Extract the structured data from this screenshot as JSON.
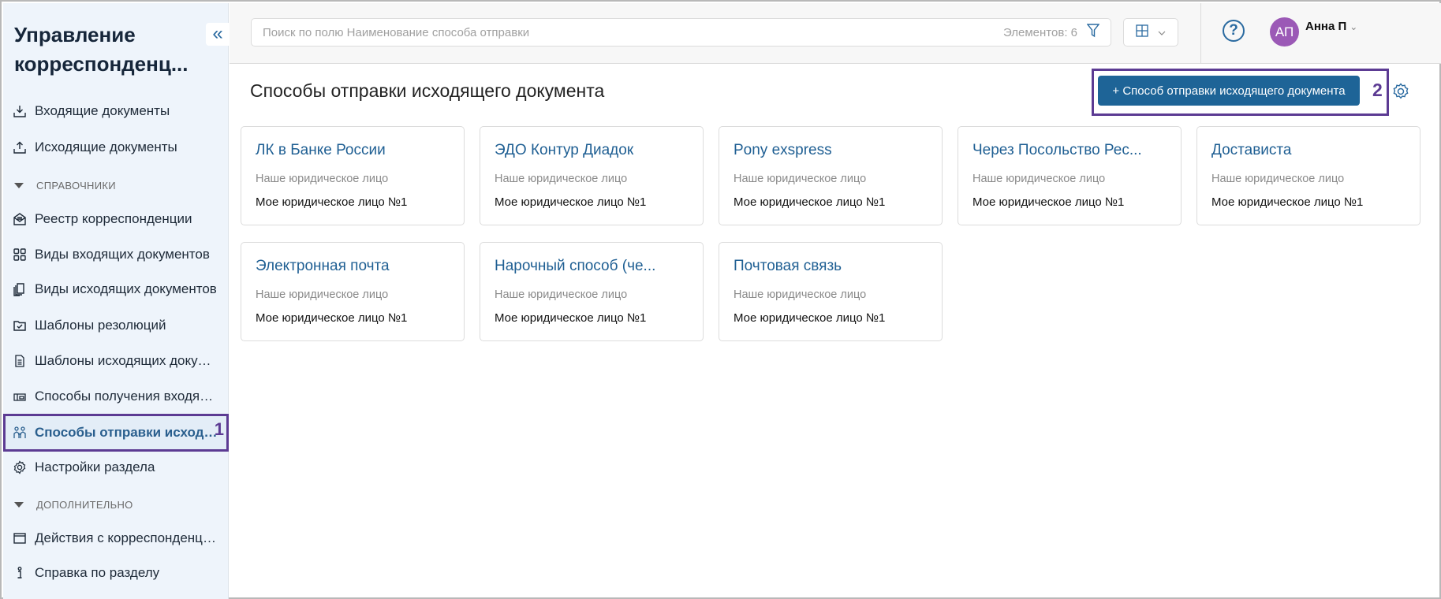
{
  "sidebar": {
    "title": "Управление корреспонденц...",
    "collapse_icon": "«",
    "items": [
      {
        "label": "Входящие документы",
        "icon": "inbox-download-icon"
      },
      {
        "label": "Исходящие документы",
        "icon": "outbox-upload-icon"
      },
      {
        "label": "Реестр корреспонденции",
        "icon": "mail-registry-icon"
      },
      {
        "label": "Виды входящих документов",
        "icon": "grid-icon"
      },
      {
        "label": "Виды исходящих документов",
        "icon": "documents-stack-icon"
      },
      {
        "label": "Шаблоны резолюций",
        "icon": "folder-check-icon"
      },
      {
        "label": "Шаблоны исходящих докумен...",
        "icon": "document-icon"
      },
      {
        "label": "Способы получения входящег...",
        "icon": "mailbox-icon"
      },
      {
        "label": "Способы отправки исходящ...",
        "icon": "people-icon",
        "active": true,
        "badge": "1"
      },
      {
        "label": "Настройки раздела",
        "icon": "gear-icon"
      },
      {
        "label": "Действия с корреспонденцией",
        "icon": "window-icon"
      },
      {
        "label": "Справка по разделу",
        "icon": "info-icon"
      }
    ],
    "sections": [
      "СПРАВОЧНИКИ",
      "ДОПОЛНИТЕЛЬНО"
    ]
  },
  "header": {
    "search_placeholder": "Поиск по полю Наименование способа отправки",
    "count": "Элементов: 6",
    "help": "?",
    "avatar_initials": "АП",
    "user_name": "Анна П"
  },
  "main": {
    "title": "Способы отправки исходящего документа",
    "add_button": "+ Способ отправки исходящего документа",
    "badge": "2",
    "cards": [
      {
        "title": "ЛК в Банке России",
        "label": "Наше юридическое лицо",
        "value": "Мое юридическое лицо №1"
      },
      {
        "title": "ЭДО Контур Диадок",
        "label": "Наше юридическое лицо",
        "value": "Мое юридическое лицо №1"
      },
      {
        "title": "Pony exspress",
        "label": "Наше юридическое лицо",
        "value": "Мое юридическое лицо №1"
      },
      {
        "title": "Через Посольство Рес...",
        "label": "Наше юридическое лицо",
        "value": "Мое юридическое лицо №1"
      },
      {
        "title": "Достависта",
        "label": "Наше юридическое лицо",
        "value": "Мое юридическое лицо №1"
      },
      {
        "title": "Электронная почта",
        "label": "Наше юридическое лицо",
        "value": "Мое юридическое лицо №1"
      },
      {
        "title": "Нарочный способ (че...",
        "label": "Наше юридическое лицо",
        "value": "Мое юридическое лицо №1"
      },
      {
        "title": "Почтовая связь",
        "label": "Наше юридическое лицо",
        "value": "Мое юридическое лицо №1"
      }
    ]
  },
  "colors": {
    "accent": "#1e6497",
    "highlight": "#5c3b93",
    "avatar": "#9b59b6",
    "sidebar_bg": "#eef4fb"
  }
}
